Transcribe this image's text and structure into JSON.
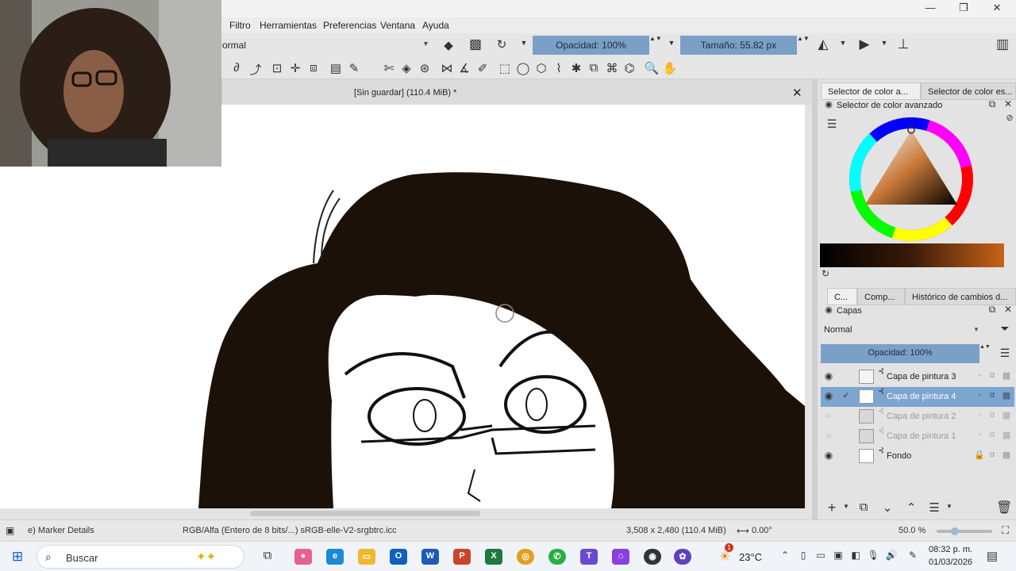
{
  "window": {
    "minimize": "—",
    "restore": "❐",
    "close": "✕"
  },
  "menu": [
    "Filtro",
    "Herramientas",
    "Preferencias",
    "Ventana",
    "Ayuda"
  ],
  "toolbar": {
    "blend_mode": "ormal",
    "opacity_label": "Opacidad: 100%",
    "size_label": "Tamaño: 55.82 px"
  },
  "document": {
    "title": "[Sin guardar]  (110.4 MiB) *",
    "close": "✕"
  },
  "dock_tabs_top": [
    "Selector de color a...",
    "Selector de color es..."
  ],
  "color_panel": {
    "title": "Selector de color avanzado"
  },
  "dock_tabs_mid": [
    "C...",
    "Comp...",
    "Histórico de cambios d..."
  ],
  "layers_panel": {
    "title": "Capas",
    "blend_mode": "Normal",
    "opacity_label": "Opacidad:  100%",
    "layers": [
      {
        "name": "Capa de pintura 3",
        "visible": true,
        "selected": false,
        "locked": false
      },
      {
        "name": "Capa de pintura 4",
        "visible": true,
        "selected": true,
        "locked": false
      },
      {
        "name": "Capa de pintura 2",
        "visible": false,
        "selected": false,
        "locked": false
      },
      {
        "name": "Capa de pintura 1",
        "visible": false,
        "selected": false,
        "locked": false
      },
      {
        "name": "Fondo",
        "visible": true,
        "selected": false,
        "locked": true
      }
    ]
  },
  "status": {
    "brush": "e) Marker Details",
    "color_space": "RGB/Alfa (Entero de 8 bits/...)  sRGB-elle-V2-srgbtrc.icc",
    "dimensions": "3,508 x 2,480 (110.4 MiB)",
    "rotation": "0.00°",
    "zoom": "50.0 %"
  },
  "taskbar": {
    "search_placeholder": "Buscar",
    "weather": "23°C",
    "time": "08:32 p. m.",
    "date": "01/03/2026",
    "weather_badge": "1"
  },
  "colors": {
    "accent": "#7ca5d0",
    "hair": "#1c1108",
    "slider": "#7aa0c8"
  }
}
